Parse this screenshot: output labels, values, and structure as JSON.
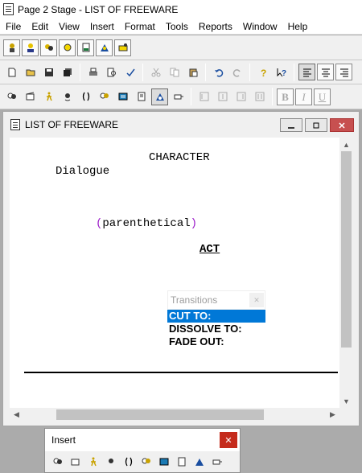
{
  "window": {
    "title": "Page 2 Stage - LIST OF FREEWARE"
  },
  "menu": [
    "File",
    "Edit",
    "View",
    "Insert",
    "Format",
    "Tools",
    "Reports",
    "Window",
    "Help"
  ],
  "toolbar": {
    "row1_icons": [
      "character-icon",
      "dialogue-icon",
      "parenthetical-icon",
      "scene-icon",
      "transition-icon",
      "act-icon",
      "stage-direction-icon"
    ],
    "row2_icons": [
      "new-file-icon",
      "open-folder-icon",
      "save-icon",
      "save-all-icon",
      "print-icon",
      "print-preview-icon",
      "spell-check-icon",
      "cut-icon",
      "copy-icon",
      "paste-icon",
      "undo-icon",
      "redo-icon",
      "help-icon",
      "context-help-icon",
      "align-left-icon",
      "align-center-icon",
      "align-right-icon"
    ],
    "row3_icons": [
      "insert-character-icon",
      "insert-dialogue-icon",
      "insert-action-icon",
      "insert-parenthetical-icon",
      "insert-bracket-icon",
      "insert-actor-icon",
      "insert-text-icon",
      "insert-note-icon",
      "insert-scene-icon",
      "insert-transition-icon",
      "column-1-icon",
      "column-2-icon",
      "column-3-icon",
      "column-4-icon"
    ],
    "format_buttons": [
      "B",
      "I",
      "U"
    ]
  },
  "document": {
    "title": "LIST OF FREEWARE",
    "character": "CHARACTER",
    "dialogue": "Dialogue",
    "paren_open": "(",
    "parenthetical": "parenthetical",
    "paren_close": ")",
    "act": "ACT"
  },
  "transitions": {
    "title": "Transitions",
    "items": [
      "CUT TO:",
      "DISSOLVE TO:",
      "FADE OUT:"
    ],
    "selected_index": 0
  },
  "insert_palette": {
    "title": "Insert"
  },
  "colors": {
    "selection": "#0078d7",
    "paren": "#9b1ac9",
    "close": "#c42b1c"
  }
}
